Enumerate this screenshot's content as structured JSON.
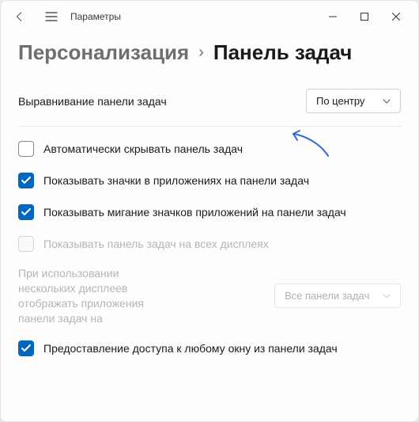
{
  "window": {
    "title": "Параметры"
  },
  "breadcrumb": {
    "parent": "Персонализация",
    "current": "Панель задач"
  },
  "alignment": {
    "label": "Выравнивание панели задач",
    "selected": "По центру"
  },
  "options": {
    "auto_hide": {
      "label": "Автоматически скрывать панель задач",
      "checked": false,
      "disabled": false
    },
    "show_badges": {
      "label": "Показывать значки в приложениях на панели задач",
      "checked": true,
      "disabled": false
    },
    "show_flash": {
      "label": "Показывать мигание значков приложений на панели задач",
      "checked": true,
      "disabled": false
    },
    "all_displays": {
      "label": "Показывать панель задач на всех дисплеях",
      "checked": false,
      "disabled": true
    },
    "multi_display": {
      "label": "При использовании нескольких дисплеев отображать приложения панели задач на",
      "selected": "Все панели задач",
      "disabled": true
    },
    "window_access": {
      "label": "Предоставление доступа к любому окну из панели задач",
      "checked": true,
      "disabled": false
    }
  }
}
